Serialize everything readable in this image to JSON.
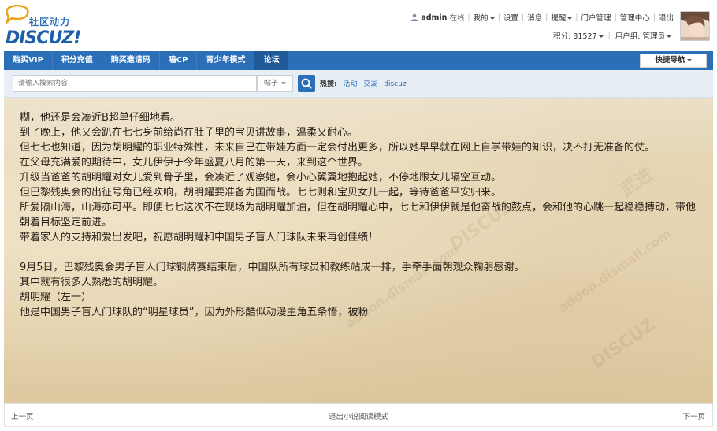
{
  "logo": {
    "cn": "社区动力",
    "en": "DISCUZ!"
  },
  "topnav": {
    "username": "admin",
    "status": "在线",
    "links": [
      "我的",
      "设置",
      "消息",
      "提醒",
      "门户管理",
      "管理中心",
      "退出"
    ]
  },
  "subnav": {
    "points": "积分: 31527",
    "group": "用户组: 管理员"
  },
  "navbar": {
    "items": [
      "购买VIP",
      "积分充值",
      "购买邀请码",
      "嗑CP",
      "青少年模式",
      "论坛"
    ],
    "active_index": 5,
    "quick_nav": "快捷导航"
  },
  "search": {
    "placeholder": "请输入搜索内容",
    "type": "帖子",
    "hot_label": "热搜:",
    "hot_links": [
      "活动",
      "交友",
      "discuz"
    ]
  },
  "novel": {
    "paragraphs": [
      "糊，他还是会凑近B超单仔细地看。",
      "到了晚上，他又会趴在七七身前给尚在肚子里的宝贝讲故事，温柔又耐心。",
      "但七七也知道，因为胡明耀的职业特殊性，未来自己在带娃方面一定会付出更多，所以她早早就在网上自学带娃的知识，决不打无准备的仗。",
      "在父母充满爱的期待中，女儿伊伊于今年盛夏八月的第一天，来到这个世界。",
      "升级当爸爸的胡明耀对女儿爱到骨子里，会凑近了观察她，会小心翼翼地抱起她，不停地跟女儿隔空互动。",
      "但巴黎残奥会的出征号角已经吹响，胡明耀要准备为国而战。七七则和宝贝女儿一起，等待爸爸平安归来。",
      "所爱隔山海，山海亦可平。即便七七这次不在现场为胡明耀加油，但在胡明耀心中，七七和伊伊就是他奋战的鼓点，会和他的心跳一起稳稳搏动，带他朝着目标坚定前进。",
      "带着家人的支持和爱出发吧，祝愿胡明耀和中国男子盲人门球队未来再创佳绩！",
      "",
      "9月5日，巴黎残奥会男子盲人门球铜牌赛结束后，中国队所有球员和教练站成一排，手牵手面朝观众鞠躬感谢。",
      "其中就有很多人熟悉的胡明耀。",
      "胡明耀（左一）",
      "他是中国男子盲人门球队的“明星球员”，因为外形酷似动漫主角五条悟，被粉"
    ]
  },
  "footer": {
    "prev": "上一页",
    "exit": "退出小说阅读模式",
    "next": "下一页"
  },
  "colors": {
    "brand": "#2b6fb8",
    "nav_active": "#1f5a98",
    "search_bg": "#e8eef6",
    "paper": "#e6d6b5"
  },
  "watermarks": [
    "DISCUZ",
    "addon.dismall.com",
    "武进"
  ]
}
